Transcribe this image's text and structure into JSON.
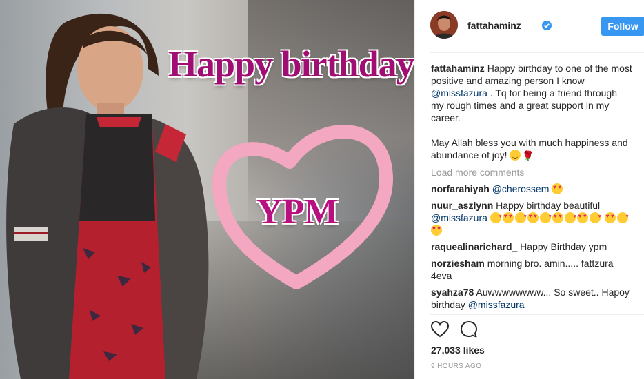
{
  "image": {
    "overlay_title": "Happy birthday",
    "overlay_heart_text": "YPM"
  },
  "post": {
    "username": "fattahaminz",
    "follow_label": "Follow",
    "caption": {
      "user": "fattahaminz",
      "text_before": "Happy birthday to one of the most positive and amazing person I know",
      "mention": "@missfazura",
      "text_after": " . Tq for being a friend through my rough times and a great support in my career.",
      "paragraph2": "May Allah bless you with much happiness and abundance of joy! "
    },
    "load_more": "Load more comments",
    "comments": [
      {
        "user": "norfarahiyah",
        "mention": "@cherossem",
        "text": ""
      },
      {
        "user": "nuur_aszlynn",
        "text": "Happy birthday beautiful",
        "mention": "@missfazura"
      },
      {
        "user": "raquealinarichard_",
        "text": "Happy Birthday ypm"
      },
      {
        "user": "norziesham",
        "text": "morning bro. amin..... fattzura 4eva"
      },
      {
        "user": "syahza78",
        "text": "Auwwwwwwww... So sweet.. Hapoy birthday",
        "mention": "@missfazura"
      }
    ],
    "likes": "27,033 likes",
    "time": "9 HOURS AGO"
  }
}
